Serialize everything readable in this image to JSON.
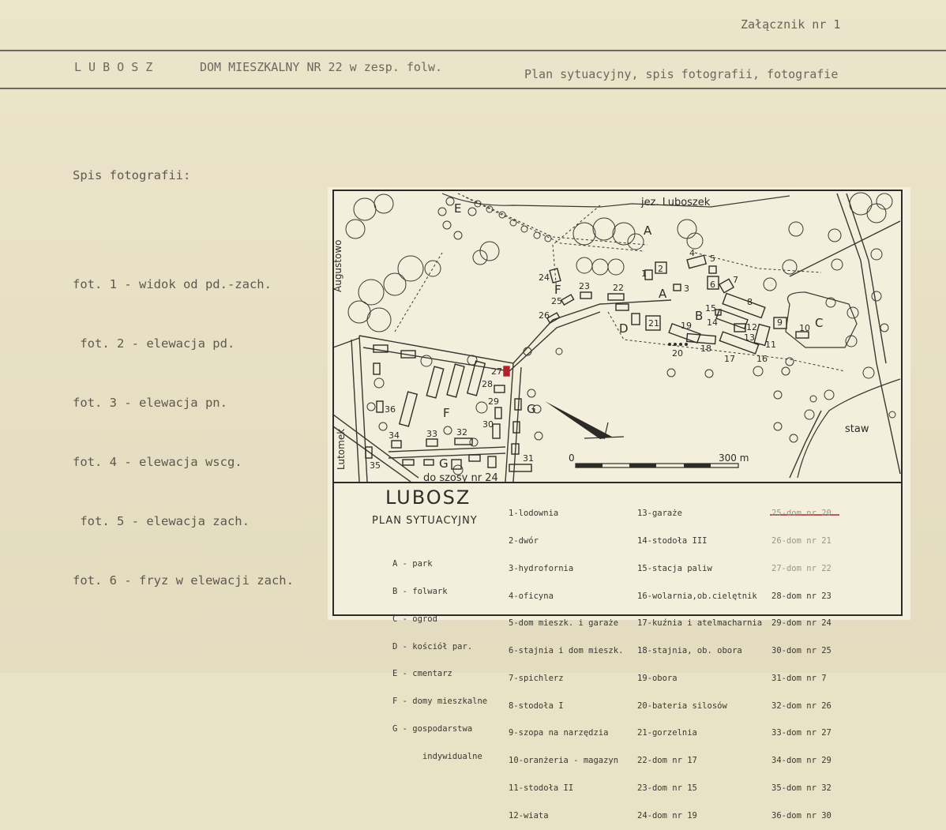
{
  "header": {
    "annex": "Załącznik nr 1",
    "place": "L U B O S Z",
    "object": "DOM MIESZKALNY NR 22 w zesp. folw.",
    "content": "Plan sytuacyjny, spis fotografii, fotografie"
  },
  "photo_list": {
    "title": "Spis fotografii:",
    "items": [
      "fot. 1 - widok od pd.-zach.",
      " fot. 2 - elewacja pd.",
      "fot. 3 - elewacja pn.",
      "fot. 4 - elewacja wscg.",
      " fot. 5 - elewacja zach.",
      "fot. 6 - fryz w elewacji zach."
    ]
  },
  "map": {
    "lake_label": "jez. Luboszek",
    "pond_label": "staw",
    "road_labels": [
      "Augustowo",
      "Lutomek",
      "do szosy nr 24"
    ],
    "scale_start": "0",
    "scale_end": "300 m",
    "area_letters": [
      "A",
      "A",
      "B",
      "C",
      "D",
      "E",
      "F",
      "F",
      "G",
      "G"
    ],
    "building_numbers": [
      "1",
      "2",
      "3",
      "4",
      "5",
      "6",
      "7",
      "8",
      "9",
      "10",
      "11",
      "12",
      "13",
      "14",
      "15",
      "16",
      "17",
      "18",
      "19",
      "20",
      "21",
      "22",
      "23",
      "24",
      "25",
      "26",
      "27",
      "28",
      "29",
      "30",
      "31",
      "32",
      "33",
      "34",
      "35",
      "36"
    ],
    "highlight_color": "#b3202a"
  },
  "legend": {
    "title": "LUBOSZ",
    "subtitle": "PLAN SYTUACYJNY",
    "letters": [
      "A - park",
      "B - folwark",
      "C - ogród",
      "D - kościół par.",
      "E - cmentarz",
      "F - domy mieszkalne",
      "G - gospodarstwa",
      "      indywidualne"
    ],
    "col1": [
      "1-lodownia",
      "2-dwór",
      "3-hydrofornia",
      "4-oficyna",
      "5-dom mieszk. i garaże",
      "6-stajnia i dom mieszk.",
      "7-spichlerz",
      "8-stodoła I",
      "9-szopa na narzędzia",
      "10-oranżeria - magazyn",
      "11-stodoła II",
      "12-wiata"
    ],
    "col2": [
      "13-garaże",
      "14-stodoła III",
      "15-stacja paliw",
      "16-wolarnia,ob.cielętnik",
      "17-kuźnia i atelmacharnia",
      "18-stajnia, ob. obora",
      "19-obora",
      "20-bateria silosów",
      "21-gorzelnia",
      "22-dom nr 17",
      "23-dom nr 15",
      "24-dom nr 19"
    ],
    "col3": [
      "25-dom nr 20",
      "26-dom nr 21",
      "27-dom nr 22",
      "28-dom nr 23",
      "29-dom nr 24",
      "30-dom nr 25",
      "31-dom nr 7",
      "32-dom nr 26",
      "33-dom nr 27",
      "34-dom nr 29",
      "35-dom nr 32",
      "36-dom nr 30"
    ]
  }
}
